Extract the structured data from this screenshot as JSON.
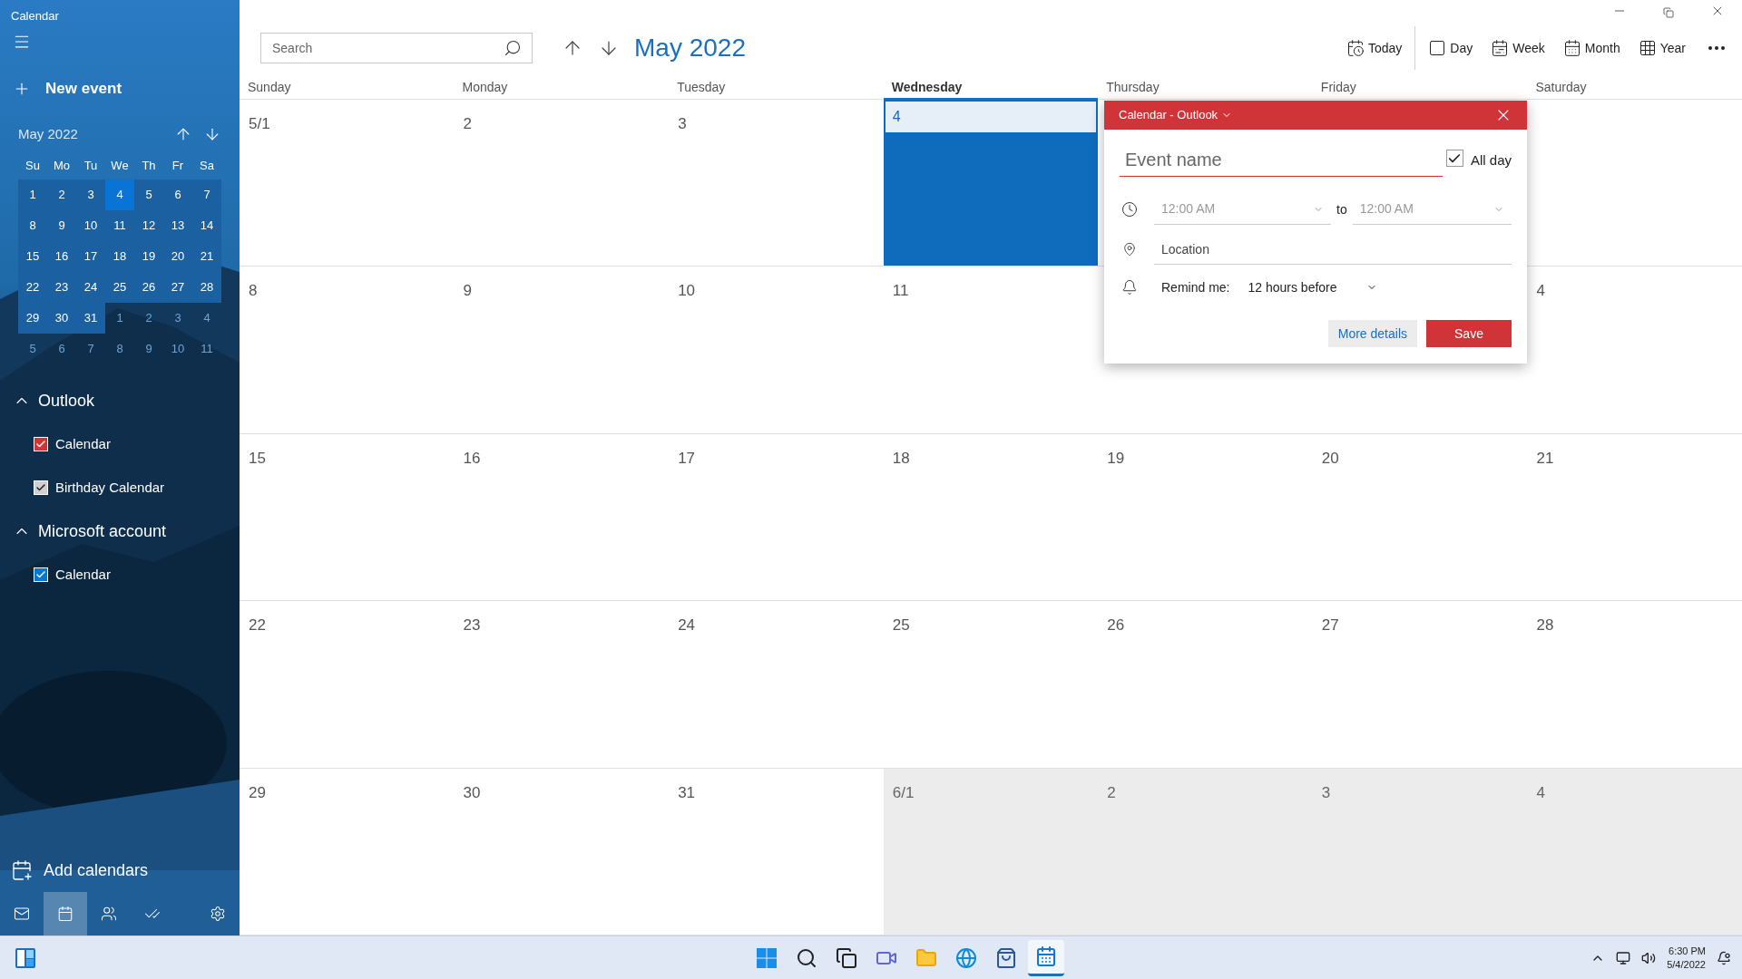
{
  "window": {
    "title": "Calendar"
  },
  "sidebar": {
    "new_event": "New event",
    "mini_calendar": {
      "title": "May 2022",
      "weekdays": [
        "Su",
        "Mo",
        "Tu",
        "We",
        "Th",
        "Fr",
        "Sa"
      ],
      "weeks": [
        [
          {
            "day": "1",
            "in_month": true,
            "selected": false
          },
          {
            "day": "2",
            "in_month": true,
            "selected": false
          },
          {
            "day": "3",
            "in_month": true,
            "selected": false
          },
          {
            "day": "4",
            "in_month": true,
            "selected": true
          },
          {
            "day": "5",
            "in_month": true,
            "selected": false
          },
          {
            "day": "6",
            "in_month": true,
            "selected": false
          },
          {
            "day": "7",
            "in_month": true,
            "selected": false
          }
        ],
        [
          {
            "day": "8",
            "in_month": true,
            "selected": false
          },
          {
            "day": "9",
            "in_month": true,
            "selected": false
          },
          {
            "day": "10",
            "in_month": true,
            "selected": false
          },
          {
            "day": "11",
            "in_month": true,
            "selected": false
          },
          {
            "day": "12",
            "in_month": true,
            "selected": false
          },
          {
            "day": "13",
            "in_month": true,
            "selected": false
          },
          {
            "day": "14",
            "in_month": true,
            "selected": false
          }
        ],
        [
          {
            "day": "15",
            "in_month": true,
            "selected": false
          },
          {
            "day": "16",
            "in_month": true,
            "selected": false
          },
          {
            "day": "17",
            "in_month": true,
            "selected": false
          },
          {
            "day": "18",
            "in_month": true,
            "selected": false
          },
          {
            "day": "19",
            "in_month": true,
            "selected": false
          },
          {
            "day": "20",
            "in_month": true,
            "selected": false
          },
          {
            "day": "21",
            "in_month": true,
            "selected": false
          }
        ],
        [
          {
            "day": "22",
            "in_month": true,
            "selected": false
          },
          {
            "day": "23",
            "in_month": true,
            "selected": false
          },
          {
            "day": "24",
            "in_month": true,
            "selected": false
          },
          {
            "day": "25",
            "in_month": true,
            "selected": false
          },
          {
            "day": "26",
            "in_month": true,
            "selected": false
          },
          {
            "day": "27",
            "in_month": true,
            "selected": false
          },
          {
            "day": "28",
            "in_month": true,
            "selected": false
          }
        ],
        [
          {
            "day": "29",
            "in_month": true,
            "selected": false
          },
          {
            "day": "30",
            "in_month": true,
            "selected": false
          },
          {
            "day": "31",
            "in_month": true,
            "selected": false
          },
          {
            "day": "1",
            "in_month": false,
            "selected": false
          },
          {
            "day": "2",
            "in_month": false,
            "selected": false
          },
          {
            "day": "3",
            "in_month": false,
            "selected": false
          },
          {
            "day": "4",
            "in_month": false,
            "selected": false
          }
        ],
        [
          {
            "day": "5",
            "in_month": false,
            "selected": false
          },
          {
            "day": "6",
            "in_month": false,
            "selected": false
          },
          {
            "day": "7",
            "in_month": false,
            "selected": false
          },
          {
            "day": "8",
            "in_month": false,
            "selected": false
          },
          {
            "day": "9",
            "in_month": false,
            "selected": false
          },
          {
            "day": "10",
            "in_month": false,
            "selected": false
          },
          {
            "day": "11",
            "in_month": false,
            "selected": false
          }
        ]
      ]
    },
    "accounts": [
      {
        "name": "Outlook",
        "expanded": true,
        "calendars": [
          {
            "name": "Calendar",
            "checked": true,
            "color": "#d13438"
          },
          {
            "name": "Birthday Calendar",
            "checked": true,
            "color": "#d0d0d0"
          }
        ]
      },
      {
        "name": "Microsoft account",
        "expanded": true,
        "calendars": [
          {
            "name": "Calendar",
            "checked": true,
            "color": "#0078d4"
          }
        ]
      }
    ],
    "add_calendars": "Add calendars",
    "nav": [
      {
        "kind": "mail",
        "selected": false
      },
      {
        "kind": "calendar",
        "selected": true
      },
      {
        "kind": "people",
        "selected": false
      },
      {
        "kind": "todo",
        "selected": false
      },
      {
        "kind": "settings",
        "selected": false
      }
    ]
  },
  "toolbar": {
    "search": {
      "placeholder": "Search"
    },
    "month_title": "May 2022",
    "views": [
      {
        "kind": "today",
        "label": "Today"
      },
      {
        "kind": "day",
        "label": "Day"
      },
      {
        "kind": "week",
        "label": "Week"
      },
      {
        "kind": "month",
        "label": "Month"
      },
      {
        "kind": "year",
        "label": "Year"
      }
    ]
  },
  "month_grid": {
    "weekdays": [
      {
        "label": "Sunday",
        "selected": false
      },
      {
        "label": "Monday",
        "selected": false
      },
      {
        "label": "Tuesday",
        "selected": false
      },
      {
        "label": "Wednesday",
        "selected": true
      },
      {
        "label": "Thursday",
        "selected": false
      },
      {
        "label": "Friday",
        "selected": false
      },
      {
        "label": "Saturday",
        "selected": false
      }
    ],
    "weeks": [
      {
        "days": [
          {
            "day": "5/1",
            "in_month": true,
            "selected": false
          },
          {
            "day": "2",
            "in_month": true,
            "selected": false
          },
          {
            "day": "3",
            "in_month": true,
            "selected": false
          },
          {
            "day": "4",
            "in_month": true,
            "selected": true
          }
        ]
      },
      {
        "days": [
          {
            "day": "8",
            "in_month": true,
            "selected": false
          },
          {
            "day": "9",
            "in_month": true,
            "selected": false
          },
          {
            "day": "10",
            "in_month": true,
            "selected": false
          },
          {
            "day": "11",
            "in_month": true,
            "selected": false
          }
        ],
        "end_days": [
          {
            "day": "4",
            "in_month": true,
            "selected": false
          }
        ]
      },
      {
        "days": [
          {
            "day": "15",
            "in_month": true,
            "selected": false
          },
          {
            "day": "16",
            "in_month": true,
            "selected": false
          },
          {
            "day": "17",
            "in_month": true,
            "selected": false
          },
          {
            "day": "18",
            "in_month": true,
            "selected": false
          },
          {
            "day": "19",
            "in_month": true,
            "selected": false
          },
          {
            "day": "20",
            "in_month": true,
            "selected": false
          },
          {
            "day": "21",
            "in_month": true,
            "selected": false
          }
        ]
      },
      {
        "days": [
          {
            "day": "22",
            "in_month": true,
            "selected": false
          },
          {
            "day": "23",
            "in_month": true,
            "selected": false
          },
          {
            "day": "24",
            "in_month": true,
            "selected": false
          },
          {
            "day": "25",
            "in_month": true,
            "selected": false
          },
          {
            "day": "26",
            "in_month": true,
            "selected": false
          },
          {
            "day": "27",
            "in_month": true,
            "selected": false
          },
          {
            "day": "28",
            "in_month": true,
            "selected": false
          }
        ]
      },
      {
        "days": [
          {
            "day": "29",
            "in_month": true,
            "selected": false
          },
          {
            "day": "30",
            "in_month": true,
            "selected": false
          },
          {
            "day": "31",
            "in_month": true,
            "selected": false
          },
          {
            "day": "6/1",
            "in_month": false,
            "selected": false
          },
          {
            "day": "2",
            "in_month": false,
            "selected": false
          },
          {
            "day": "3",
            "in_month": false,
            "selected": false
          },
          {
            "day": "4",
            "in_month": false,
            "selected": false
          }
        ]
      }
    ]
  },
  "popup": {
    "calendar": "Calendar - Outlook",
    "event_name": {
      "placeholder": "Event name"
    },
    "all_day": {
      "label": "All day",
      "checked": true
    },
    "start_time": "12:00 AM",
    "to": "to",
    "end_time": "12:00 AM",
    "location": {
      "placeholder": "Location"
    },
    "remind_label": "Remind me:",
    "remind_value": "12 hours before",
    "buttons": [
      {
        "kind": "secondary",
        "label": "More details"
      },
      {
        "kind": "primary",
        "label": "Save"
      }
    ]
  },
  "taskbar": {
    "apps": [
      {
        "kind": "start",
        "active": false
      },
      {
        "kind": "search",
        "active": false
      },
      {
        "kind": "task-view",
        "active": false
      },
      {
        "kind": "chat",
        "active": false
      },
      {
        "kind": "explorer",
        "active": false
      },
      {
        "kind": "browser",
        "active": false
      },
      {
        "kind": "store",
        "active": false
      },
      {
        "kind": "calendar",
        "active": true
      }
    ],
    "time": "6:30 PM",
    "date": "5/4/2022"
  }
}
